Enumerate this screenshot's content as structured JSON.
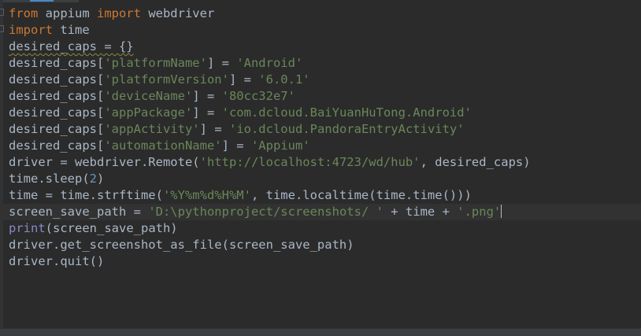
{
  "editor": {
    "lines": [
      {
        "segments": [
          {
            "t": "from",
            "c": "kw"
          },
          {
            "t": " appium ",
            "c": ""
          },
          {
            "t": "import",
            "c": "kw"
          },
          {
            "t": " webdriver",
            "c": ""
          }
        ]
      },
      {
        "segments": [
          {
            "t": "import",
            "c": "kw"
          },
          {
            "t": " time",
            "c": ""
          }
        ]
      },
      {
        "segments": [
          {
            "t": "desired_caps = {}",
            "c": "squiggle"
          }
        ]
      },
      {
        "segments": [
          {
            "t": "desired_caps[",
            "c": ""
          },
          {
            "t": "'platformName'",
            "c": "str"
          },
          {
            "t": "] = ",
            "c": ""
          },
          {
            "t": "'Android'",
            "c": "str"
          }
        ]
      },
      {
        "segments": [
          {
            "t": "desired_caps[",
            "c": ""
          },
          {
            "t": "'platformVersion'",
            "c": "str"
          },
          {
            "t": "] = ",
            "c": ""
          },
          {
            "t": "'6.0.1'",
            "c": "str"
          }
        ]
      },
      {
        "segments": [
          {
            "t": "desired_caps[",
            "c": ""
          },
          {
            "t": "'deviceName'",
            "c": "str"
          },
          {
            "t": "] = ",
            "c": ""
          },
          {
            "t": "'80cc32e7'",
            "c": "str"
          }
        ]
      },
      {
        "segments": [
          {
            "t": "desired_caps[",
            "c": ""
          },
          {
            "t": "'appPackage'",
            "c": "str"
          },
          {
            "t": "] = ",
            "c": ""
          },
          {
            "t": "'com.dcloud.BaiYuanHuTong.Android'",
            "c": "str"
          }
        ]
      },
      {
        "segments": [
          {
            "t": "desired_caps[",
            "c": ""
          },
          {
            "t": "'appActivity'",
            "c": "str"
          },
          {
            "t": "] = ",
            "c": ""
          },
          {
            "t": "'io.dcloud.PandoraEntryActivity'",
            "c": "str"
          }
        ]
      },
      {
        "segments": [
          {
            "t": "desired_caps[",
            "c": ""
          },
          {
            "t": "'automationName'",
            "c": "str"
          },
          {
            "t": "] = ",
            "c": ""
          },
          {
            "t": "'Appium'",
            "c": "str"
          }
        ]
      },
      {
        "segments": [
          {
            "t": "driver = webdriver.Remote(",
            "c": ""
          },
          {
            "t": "'http://localhost:4723/wd/hub'",
            "c": "str"
          },
          {
            "t": ", desired_caps)",
            "c": ""
          }
        ]
      },
      {
        "segments": [
          {
            "t": "time.sleep(",
            "c": ""
          },
          {
            "t": "2",
            "c": "num"
          },
          {
            "t": ")",
            "c": ""
          }
        ]
      },
      {
        "segments": [
          {
            "t": "time = time.strftime(",
            "c": ""
          },
          {
            "t": "'%Y%m%d%H%M'",
            "c": "str"
          },
          {
            "t": ", time.localtime(time.time()))",
            "c": ""
          }
        ]
      },
      {
        "current": true,
        "segments": [
          {
            "t": "screen_save_path = ",
            "c": ""
          },
          {
            "t": "'D:\\pythonproject/screenshots/ '",
            "c": "str"
          },
          {
            "t": " + time + ",
            "c": ""
          },
          {
            "t": "'.png'",
            "c": "str"
          }
        ]
      },
      {
        "segments": [
          {
            "t": "print",
            "c": "bi"
          },
          {
            "t": "(screen_save_path)",
            "c": ""
          }
        ]
      },
      {
        "segments": [
          {
            "t": "driver.get_screenshot_as_file(screen_save_path)",
            "c": ""
          }
        ]
      },
      {
        "segments": [
          {
            "t": "driver.quit()",
            "c": ""
          }
        ]
      }
    ]
  },
  "colors": {
    "background": "#2b2b2b",
    "keyword": "#cc7832",
    "string": "#6a8759",
    "number": "#6897bb",
    "builtin": "#8888c6",
    "default_text": "#a9b7c6"
  }
}
